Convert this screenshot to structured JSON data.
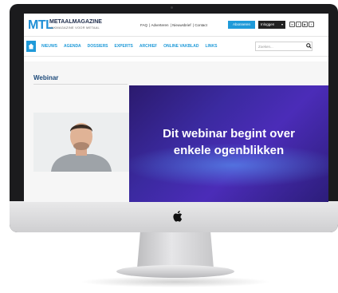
{
  "site": {
    "logo_mark": "MTL",
    "logo_name": "METAALMAGAZINE",
    "logo_tagline": "VAKMAGAZINE VOOR METAAL"
  },
  "toplinks": [
    "FAQ",
    "Adverteren",
    "Nieuwsbrief",
    "Contact"
  ],
  "header_buttons": {
    "subscribe": "Abonneren",
    "login": "Inloggen"
  },
  "nav": {
    "items": [
      "NIEUWS",
      "AGENDA",
      "DOSSIERS",
      "EXPERTS",
      "ARCHIEF",
      "ONLINE VAKBLAD",
      "LINKS"
    ]
  },
  "search": {
    "placeholder": "Zoeken..."
  },
  "page": {
    "title": "Webinar"
  },
  "webinar_banner": {
    "line1": "Dit webinar begint over",
    "line2": "enkele ogenblikken"
  },
  "colors": {
    "accent": "#1f9ad9",
    "banner": "#3b2aa0"
  }
}
